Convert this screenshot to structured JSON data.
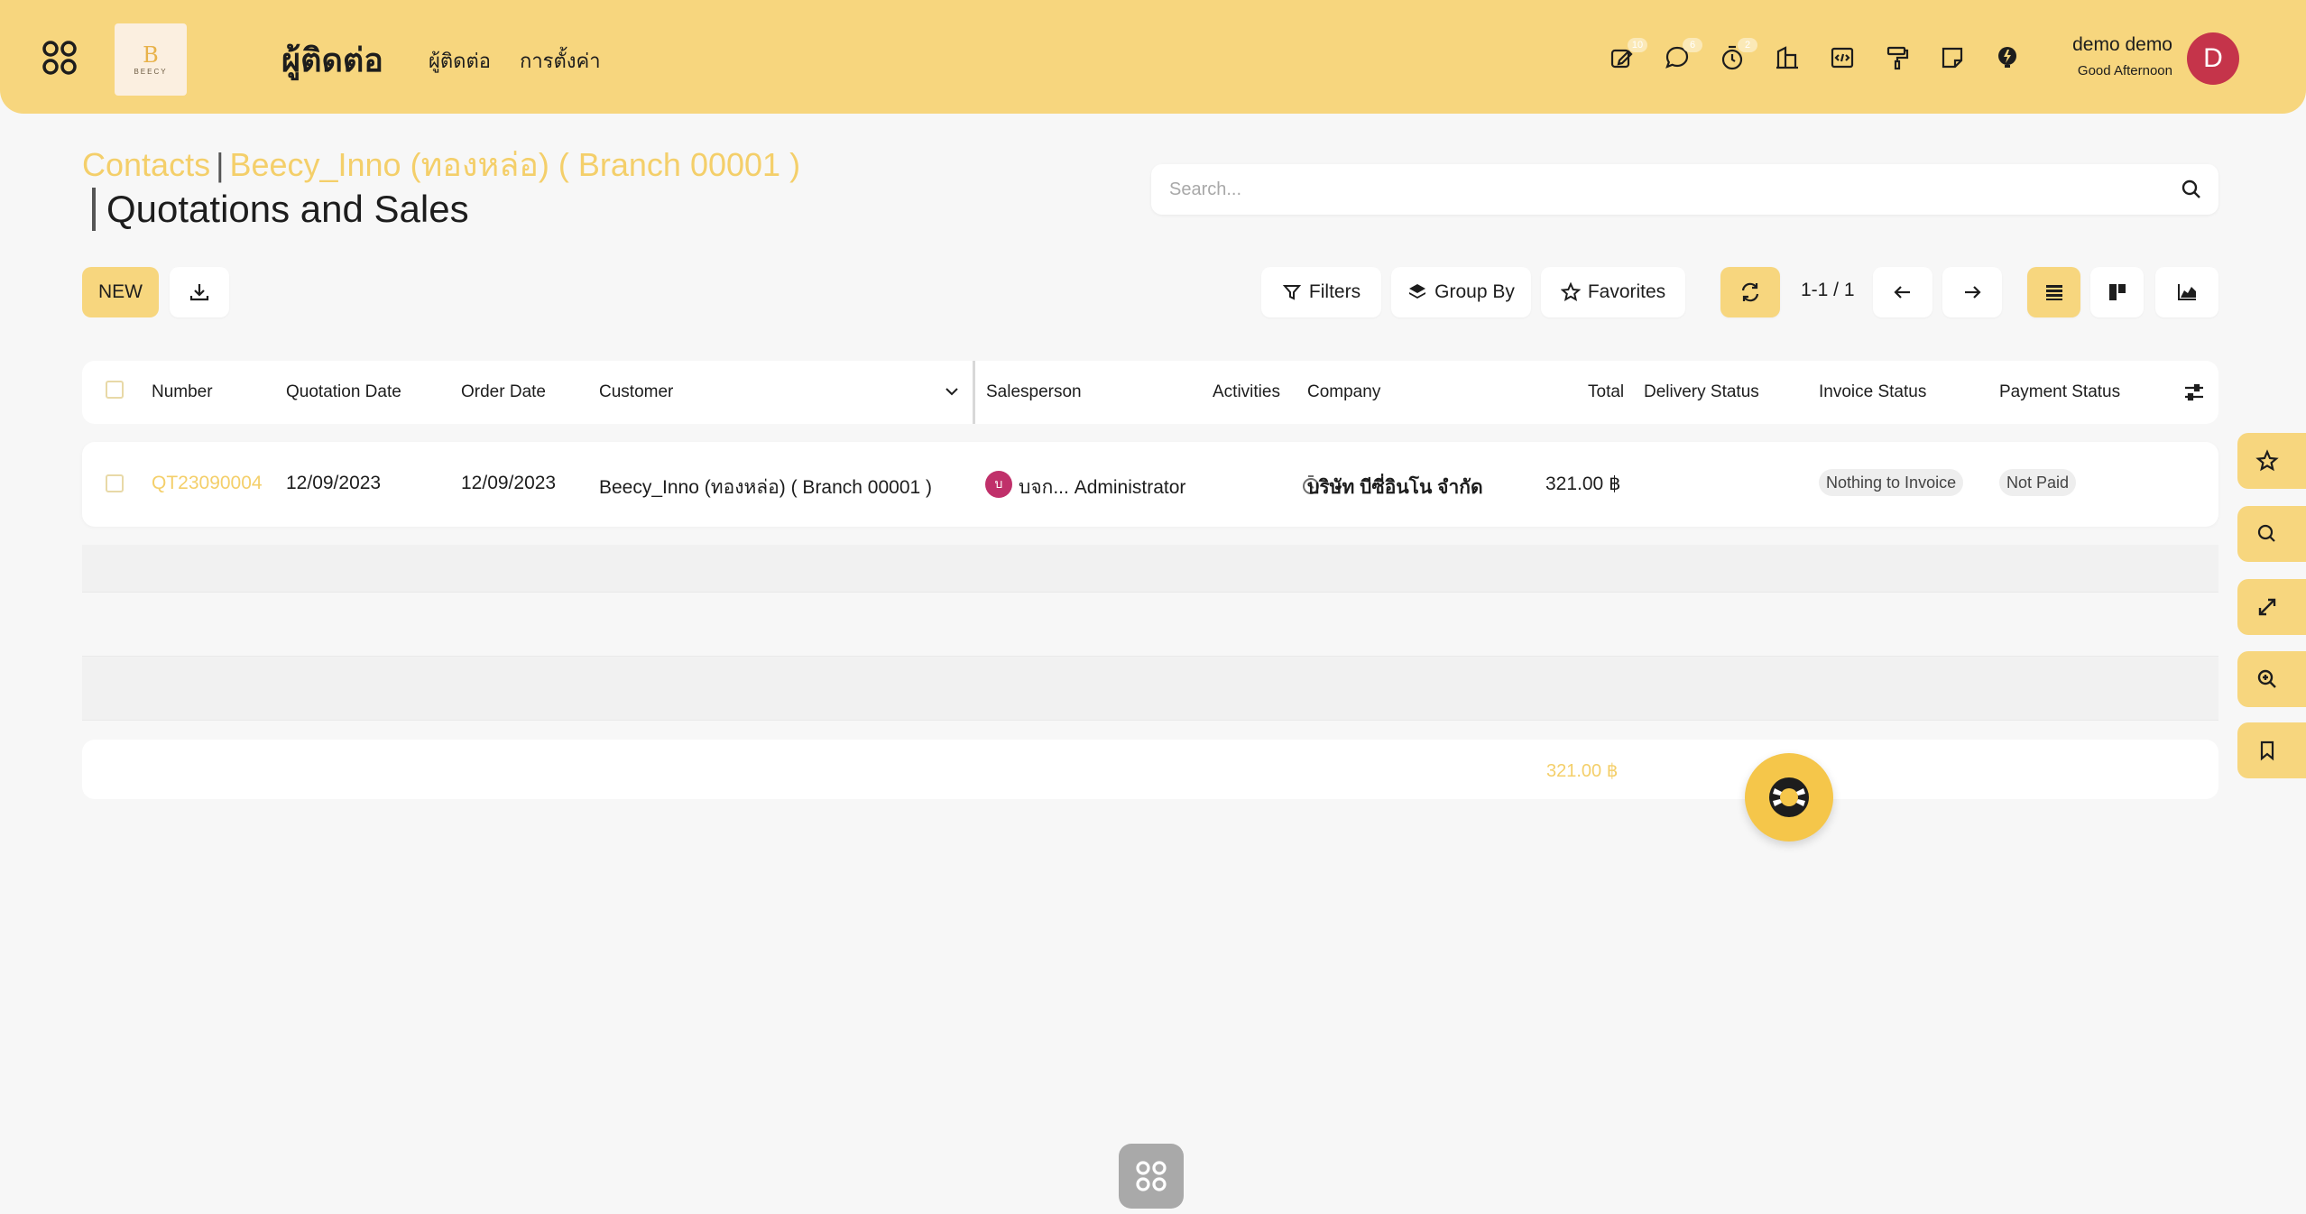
{
  "header": {
    "logo_text": "BEECY",
    "app_title": "ผู้ติดต่อ",
    "nav": [
      "ผู้ติดต่อ",
      "การตั้งค่า"
    ],
    "badges": {
      "activity": "10",
      "messages": "6",
      "timer": "2"
    },
    "user_name": "demo demo",
    "greeting": "Good Afternoon",
    "avatar_letter": "D"
  },
  "breadcrumb": {
    "root": "Contacts",
    "contact": "Beecy_Inno (ทองหล่อ) ( Branch 00001 )",
    "title": "Quotations and Sales"
  },
  "search": {
    "placeholder": "Search..."
  },
  "toolbar": {
    "new_label": "NEW",
    "filters_label": "Filters",
    "groupby_label": "Group By",
    "favorites_label": "Favorites",
    "pager": "1-1 / 1"
  },
  "table": {
    "columns": {
      "number": "Number",
      "quotation_date": "Quotation Date",
      "order_date": "Order Date",
      "customer": "Customer",
      "salesperson": "Salesperson",
      "activities": "Activities",
      "company": "Company",
      "total": "Total",
      "delivery_status": "Delivery Status",
      "invoice_status": "Invoice Status",
      "payment_status": "Payment Status"
    },
    "rows": [
      {
        "number": "QT23090004",
        "quotation_date": "12/09/2023",
        "order_date": "12/09/2023",
        "customer": "Beecy_Inno (ทองหล่อ) ( Branch 00001 )",
        "salesperson_initial": "บ",
        "salesperson": "บจก... Administrator",
        "company": "บริษัท บีซี่อินโน จำกัด",
        "total": "321.00 ฿",
        "delivery_status": "",
        "invoice_status": "Nothing to Invoice",
        "payment_status": "Not Paid"
      }
    ],
    "footer_total": "321.00 ฿"
  },
  "colors": {
    "accent": "#f7d67e",
    "link": "#f4cf6a",
    "avatar": "#c5344a",
    "salesperson_avatar": "#c0306a",
    "fab": "#f5c64a"
  },
  "icons": {
    "topbar": [
      "apps-icon",
      "activity-icon",
      "chat-icon",
      "timer-icon",
      "company-icon",
      "code-icon",
      "paint-roller-icon",
      "note-icon",
      "bolt-icon"
    ],
    "side_panel": [
      "star-icon",
      "search-icon",
      "expand-icon",
      "zoom-in-icon",
      "bookmark-icon"
    ]
  }
}
